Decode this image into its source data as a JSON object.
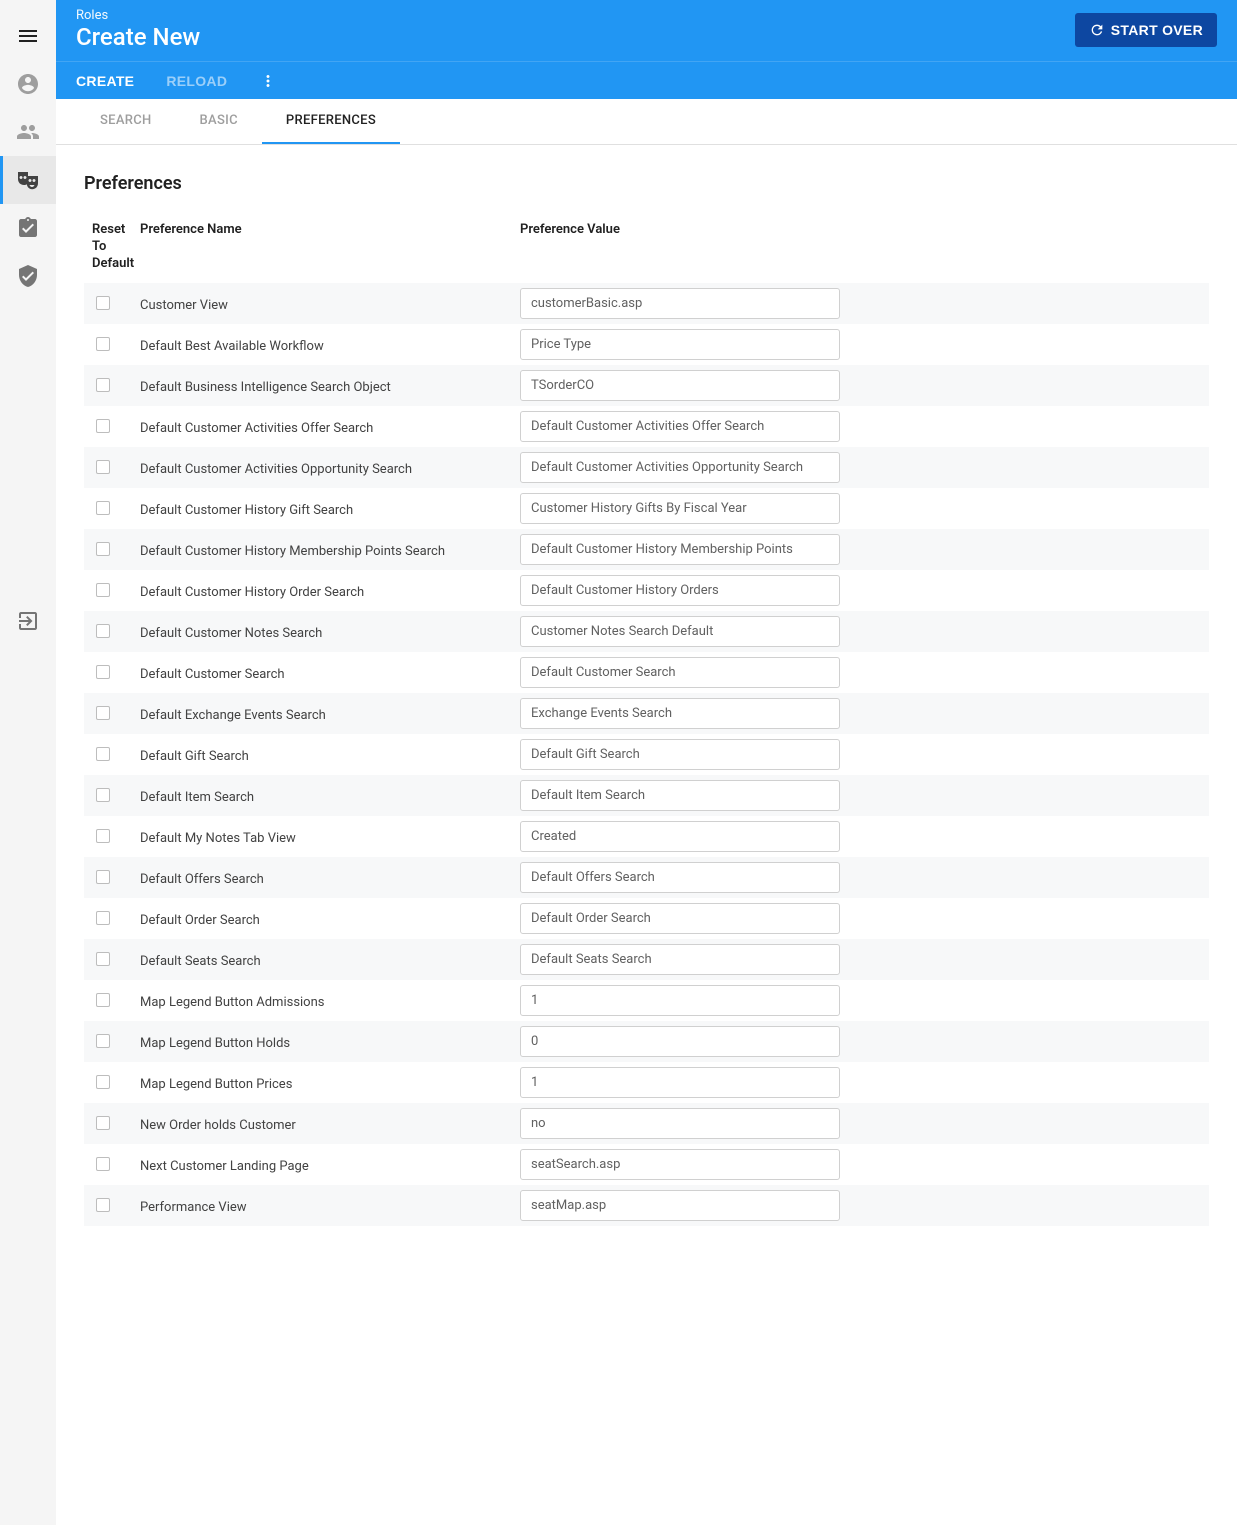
{
  "header": {
    "breadcrumb": "Roles",
    "title": "Create New",
    "start_over_label": "START OVER"
  },
  "actions": {
    "create_label": "CREATE",
    "reload_label": "RELOAD"
  },
  "tabs": [
    {
      "label": "SEARCH",
      "active": false
    },
    {
      "label": "BASIC",
      "active": false
    },
    {
      "label": "PREFERENCES",
      "active": true
    }
  ],
  "section_title": "Preferences",
  "columns": {
    "reset": "Reset To Default",
    "name": "Preference Name",
    "value": "Preference Value"
  },
  "preferences": [
    {
      "name": "Customer View",
      "value": "customerBasic.asp"
    },
    {
      "name": "Default Best Available Workflow",
      "value": "Price Type"
    },
    {
      "name": "Default Business Intelligence Search Object",
      "value": "TSorderCO"
    },
    {
      "name": "Default Customer Activities Offer Search",
      "value": "Default Customer Activities Offer Search"
    },
    {
      "name": "Default Customer Activities Opportunity Search",
      "value": "Default Customer Activities Opportunity Search"
    },
    {
      "name": "Default Customer History Gift Search",
      "value": "Customer History Gifts By Fiscal Year"
    },
    {
      "name": "Default Customer History Membership Points Search",
      "value": "Default Customer History Membership Points"
    },
    {
      "name": "Default Customer History Order Search",
      "value": "Default Customer History Orders"
    },
    {
      "name": "Default Customer Notes Search",
      "value": "Customer Notes Search Default"
    },
    {
      "name": "Default Customer Search",
      "value": "Default Customer Search"
    },
    {
      "name": "Default Exchange Events Search",
      "value": "Exchange Events Search"
    },
    {
      "name": "Default Gift Search",
      "value": "Default Gift Search"
    },
    {
      "name": "Default Item Search",
      "value": "Default Item Search"
    },
    {
      "name": "Default My Notes Tab View",
      "value": "Created"
    },
    {
      "name": "Default Offers Search",
      "value": "Default Offers Search"
    },
    {
      "name": "Default Order Search",
      "value": "Default Order Search"
    },
    {
      "name": "Default Seats Search",
      "value": "Default Seats Search"
    },
    {
      "name": "Map Legend Button Admissions",
      "value": "1"
    },
    {
      "name": "Map Legend Button Holds",
      "value": "0"
    },
    {
      "name": "Map Legend Button Prices",
      "value": "1"
    },
    {
      "name": "New Order holds Customer",
      "value": "no"
    },
    {
      "name": "Next Customer Landing Page",
      "value": "seatSearch.asp"
    },
    {
      "name": "Performance View",
      "value": "seatMap.asp"
    }
  ]
}
